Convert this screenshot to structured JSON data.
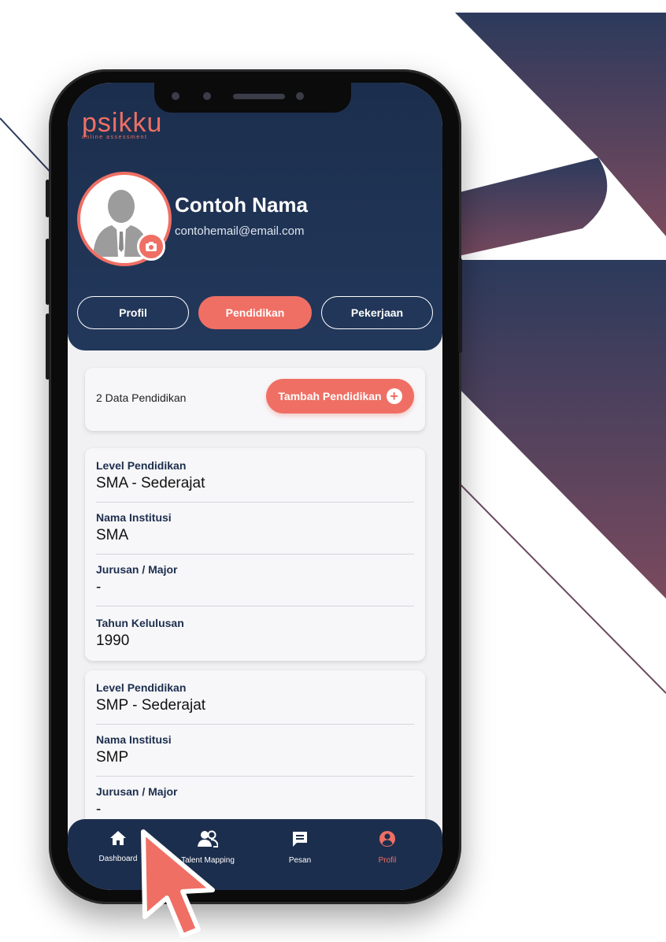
{
  "app": {
    "logo_word": "psikku",
    "logo_tagline": "online assessment"
  },
  "profile": {
    "name": "Contoh Nama",
    "email": "contohemail@email.com"
  },
  "tabs": [
    {
      "label": "Profil",
      "active": false
    },
    {
      "label": "Pendidikan",
      "active": true
    },
    {
      "label": "Pekerjaan",
      "active": false
    }
  ],
  "summary": {
    "count_text": "2 Data Pendidikan",
    "add_button_label": "Tambah Pendidikan"
  },
  "education": [
    {
      "fields": [
        {
          "label": "Level Pendidikan",
          "value": "SMA - Sederajat"
        },
        {
          "label": "Nama Institusi",
          "value": "SMA"
        },
        {
          "label": "Jurusan / Major",
          "value": "-"
        },
        {
          "label": "Tahun Kelulusan",
          "value": "1990"
        }
      ]
    },
    {
      "fields": [
        {
          "label": "Level Pendidikan",
          "value": "SMP - Sederajat"
        },
        {
          "label": "Nama Institusi",
          "value": "SMP"
        },
        {
          "label": "Jurusan / Major",
          "value": "-"
        }
      ]
    }
  ],
  "nav": [
    {
      "label": "Dashboard",
      "icon": "home-icon",
      "active": false
    },
    {
      "label": "Talent Mapping",
      "icon": "users-icon",
      "active": false
    },
    {
      "label": "Pesan",
      "icon": "message-icon",
      "active": false
    },
    {
      "label": "Profil",
      "icon": "user-circle-icon",
      "active": true
    }
  ],
  "colors": {
    "brand_navy": "#1c2e4d",
    "accent_coral": "#ef6f64",
    "background_light": "#f1f1f3"
  }
}
